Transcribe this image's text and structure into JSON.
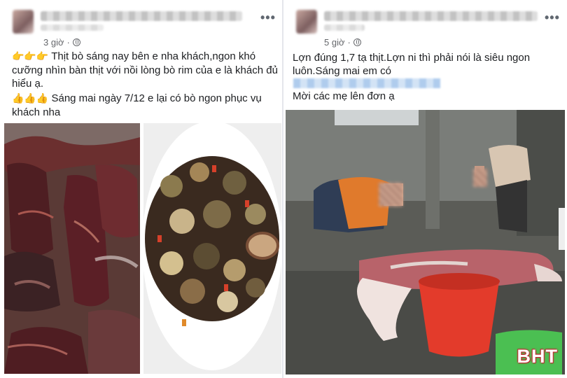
{
  "left_post": {
    "time": "3 giờ",
    "more_label": "•••",
    "line1_emoji": "👉👉👉",
    "line1_text": "Thịt bò sáng nay bên e nha khách,ngon khó cưỡng nhìn bàn thịt với nồi lòng bò rim của e là khách đủ hiểu ạ.",
    "line2_emoji": "👍👍👍",
    "line2_text": "Sáng mai ngày 7/12 e lại có bò ngon phục vụ khách nha"
  },
  "right_post": {
    "time": "5 giờ",
    "more_label": "•••",
    "text": "Lợn đúng 1,7 tạ thịt.Lợn ni thì phải nói là siêu ngon luôn.Sáng mai em có",
    "text2": "Mời các mẹ lên đơn ạ",
    "watermark": "BHT"
  },
  "icons": {
    "privacy": "globe-icon",
    "menu": "more-options-icon"
  }
}
